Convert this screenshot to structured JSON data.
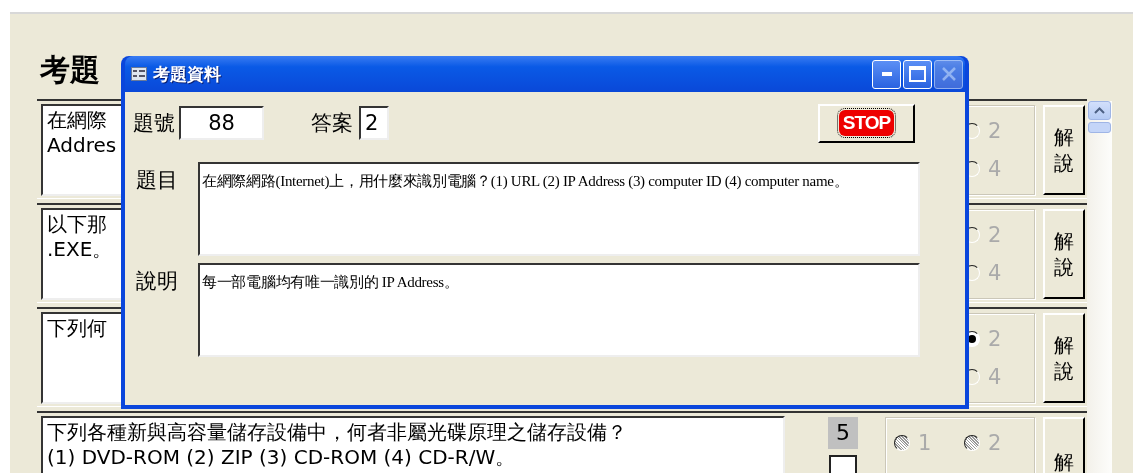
{
  "form": {
    "title": "考題",
    "rows": [
      {
        "kind": "covered",
        "lines": [
          "在網際",
          "Addres"
        ],
        "options": [
          {
            "label": "2",
            "selected": false
          },
          {
            "label": "4",
            "selected": false
          }
        ],
        "indeterminate": false,
        "button": "解說"
      },
      {
        "kind": "covered",
        "lines": [
          "以下那",
          ".EXE。"
        ],
        "options": [
          {
            "label": "2",
            "selected": false
          },
          {
            "label": "4",
            "selected": false
          }
        ],
        "indeterminate": false,
        "button": "解說"
      },
      {
        "kind": "covered",
        "lines": [
          "下列何"
        ],
        "options": [
          {
            "label": "2",
            "selected": true
          },
          {
            "label": "4",
            "selected": false
          }
        ],
        "indeterminate": false,
        "button": "解說"
      },
      {
        "kind": "full",
        "lines": [
          "下列各種新與高容量儲存設備中，何者非屬光碟原理之儲存設備？",
          "(1) DVD-ROM  (2) ZIP  (3) CD-ROM  (4) CD-R/W。"
        ],
        "number": "5",
        "options": [
          {
            "label": "1",
            "selected": false
          },
          {
            "label": "2",
            "selected": false
          }
        ],
        "indeterminate": true,
        "button": "解"
      }
    ]
  },
  "dialog": {
    "title": "考題資料",
    "close_disabled": true,
    "number_label": "題號",
    "number": "88",
    "answer_label": "答案",
    "answer": "2",
    "stop_button": "STOP",
    "question_label": "題目",
    "question": "在網際網路(Internet)上，用什麼來識別電腦？(1) URL  (2) IP Address  (3) computer ID  (4) computer name。",
    "explanation_label": "說明",
    "explanation": "每一部電腦均有唯一識別的 IP Address。"
  }
}
